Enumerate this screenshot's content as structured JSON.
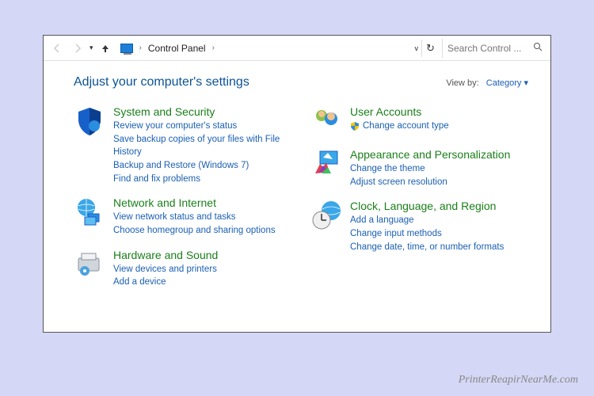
{
  "nav": {
    "breadcrumb": "Control Panel",
    "search_placeholder": "Search Control ..."
  },
  "header": {
    "title": "Adjust your computer's settings",
    "viewby_label": "View by:",
    "viewby_value": "Category"
  },
  "left": [
    {
      "title": "System and Security",
      "links": [
        "Review your computer's status",
        "Save backup copies of your files with File History",
        "Backup and Restore (Windows 7)",
        "Find and fix problems"
      ]
    },
    {
      "title": "Network and Internet",
      "links": [
        "View network status and tasks",
        "Choose homegroup and sharing options"
      ]
    },
    {
      "title": "Hardware and Sound",
      "links": [
        "View devices and printers",
        "Add a device"
      ]
    }
  ],
  "right": [
    {
      "title": "User Accounts",
      "links": [
        "Change account type"
      ],
      "shield": true
    },
    {
      "title": "Appearance and Personalization",
      "links": [
        "Change the theme",
        "Adjust screen resolution"
      ]
    },
    {
      "title": "Clock, Language, and Region",
      "links": [
        "Add a language",
        "Change input methods",
        "Change date, time, or number formats"
      ]
    }
  ],
  "watermark": "PrinterReapirNearMe.com"
}
